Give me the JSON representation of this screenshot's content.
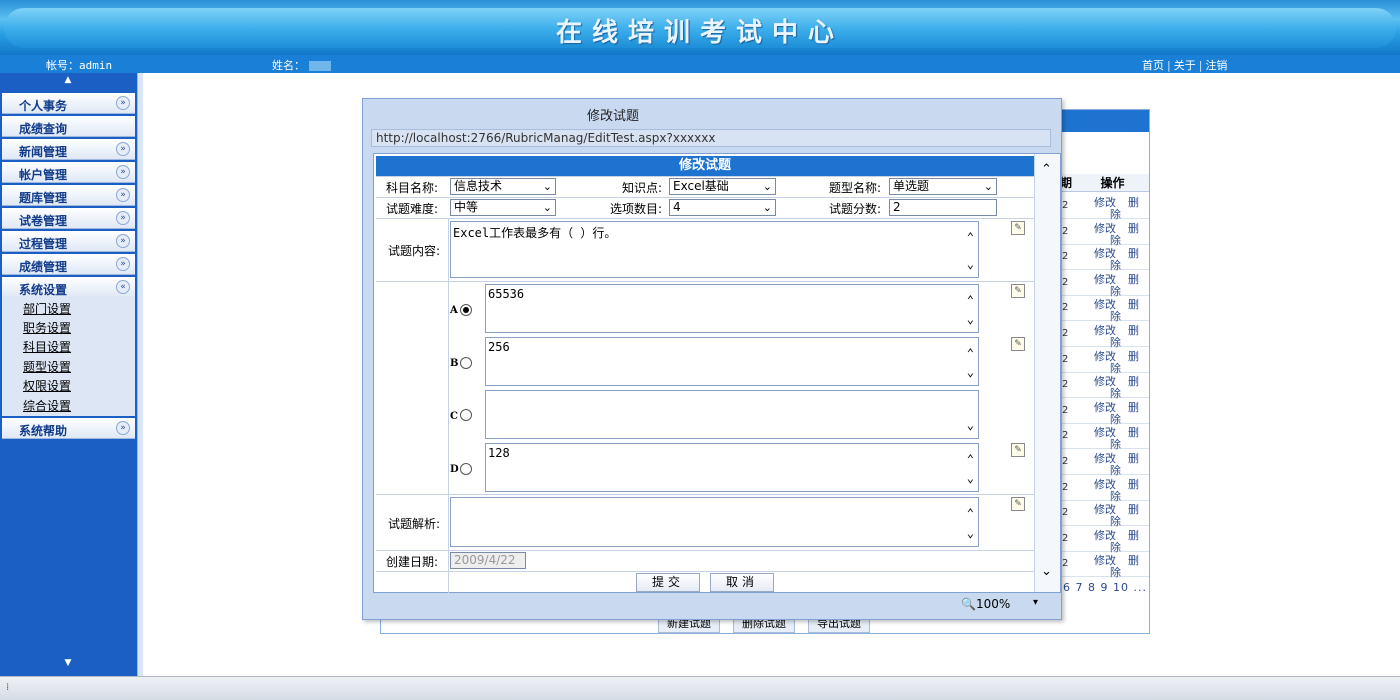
{
  "banner": {
    "title": "在线培训考试中心"
  },
  "infobar": {
    "account_label": "帐号：admin",
    "name_label": "姓名：",
    "links": [
      "首页",
      "关于",
      "注销"
    ],
    "separator": "|"
  },
  "sidebar": {
    "items": [
      {
        "label": "个人事务",
        "chevron": "»"
      },
      {
        "label": "成绩查询",
        "chevron": ""
      },
      {
        "label": "新闻管理",
        "chevron": "»"
      },
      {
        "label": "帐户管理",
        "chevron": "»"
      },
      {
        "label": "题库管理",
        "chevron": "»"
      },
      {
        "label": "试卷管理",
        "chevron": "»"
      },
      {
        "label": "过程管理",
        "chevron": "»"
      },
      {
        "label": "成绩管理",
        "chevron": "»"
      },
      {
        "label": "系统设置",
        "chevron": "«"
      },
      {
        "label": "系统帮助",
        "chevron": "»"
      }
    ],
    "submenu": [
      "部门设置",
      "职务设置",
      "科目设置",
      "题型设置",
      "权限设置",
      "综合设置"
    ]
  },
  "background_table": {
    "col_headers": [
      "期",
      "操作"
    ],
    "row_value": "2",
    "edit_label": "修改",
    "delete_label_top": "删",
    "delete_label_bottom": "除",
    "row_count": 15,
    "pager": "6 7 8 9 10 ...",
    "buttons": [
      "新建试题",
      "删除试题",
      "导出试题"
    ]
  },
  "modal": {
    "title": "修改试题",
    "url": "http://localhost:2766/RubricManag/EditTest.aspx?xxxxxx",
    "zoom": "100%",
    "form": {
      "heading": "修改试题",
      "subject_label": "科目名称:",
      "subject_value": "信息技术",
      "knowledge_label": "知识点:",
      "knowledge_value": "Excel基础",
      "type_label": "题型名称:",
      "type_value": "单选题",
      "difficulty_label": "试题难度:",
      "difficulty_value": "中等",
      "option_count_label": "选项数目:",
      "option_count_value": "4",
      "score_label": "试题分数:",
      "score_value": "2",
      "content_label": "试题内容:",
      "content_value": "Excel工作表最多有（      ）行。",
      "options": [
        {
          "letter": "A",
          "selected": true,
          "text": "65536"
        },
        {
          "letter": "B",
          "selected": false,
          "text": "256"
        },
        {
          "letter": "C",
          "selected": false,
          "text": ""
        },
        {
          "letter": "D",
          "selected": false,
          "text": "128"
        }
      ],
      "analysis_label": "试题解析:",
      "analysis_value": "",
      "created_label": "创建日期:",
      "created_value": "2009/4/22",
      "submit_label": "提交",
      "cancel_label": "取消"
    }
  }
}
